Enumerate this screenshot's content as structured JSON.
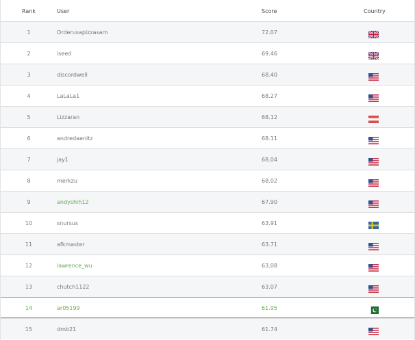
{
  "headers": {
    "rank": "Rank",
    "user": "User",
    "score": "Score",
    "country": "Country"
  },
  "rows": [
    {
      "rank": "1",
      "user": "Orderusapizzasam",
      "score": "72.07",
      "country": "gb-flag"
    },
    {
      "rank": "2",
      "user": "iseed",
      "score": "69.46",
      "country": "gb-flag"
    },
    {
      "rank": "3",
      "user": "discordwell",
      "score": "68.40",
      "country": "us-flag"
    },
    {
      "rank": "4",
      "user": "LaLaLa1",
      "score": "68.27",
      "country": "us-flag"
    },
    {
      "rank": "5",
      "user": "Lizzaran",
      "score": "68.12",
      "country": "at-flag"
    },
    {
      "rank": "6",
      "user": "andredaenitz",
      "score": "68.11",
      "country": "us-flag"
    },
    {
      "rank": "7",
      "user": "jay1",
      "score": "68.04",
      "country": "us-flag"
    },
    {
      "rank": "8",
      "user": "merkzu",
      "score": "68.02",
      "country": "us-flag"
    },
    {
      "rank": "9",
      "user": "andyshih12",
      "score": "67.90",
      "country": "us-flag",
      "user_color": "#6aaa4f"
    },
    {
      "rank": "10",
      "user": "snursus",
      "score": "63.91",
      "country": "se-flag"
    },
    {
      "rank": "11",
      "user": "afkmaster",
      "score": "63.71",
      "country": "us-flag"
    },
    {
      "rank": "12",
      "user": "lawrence_wu",
      "score": "63.08",
      "country": "us-flag",
      "user_color": "#6aaa4f"
    },
    {
      "rank": "13",
      "user": "chutch1122",
      "score": "63.07",
      "country": "us-flag"
    },
    {
      "rank": "14",
      "user": "ar05199",
      "score": "61.95",
      "country": "pk-flag",
      "highlighted": true
    },
    {
      "rank": "15",
      "user": "dmb21",
      "score": "61.74",
      "country": "us-flag"
    }
  ],
  "colors": {
    "highlight_border": "#3fb9a0",
    "highlight_text": "#6aaa4f"
  }
}
